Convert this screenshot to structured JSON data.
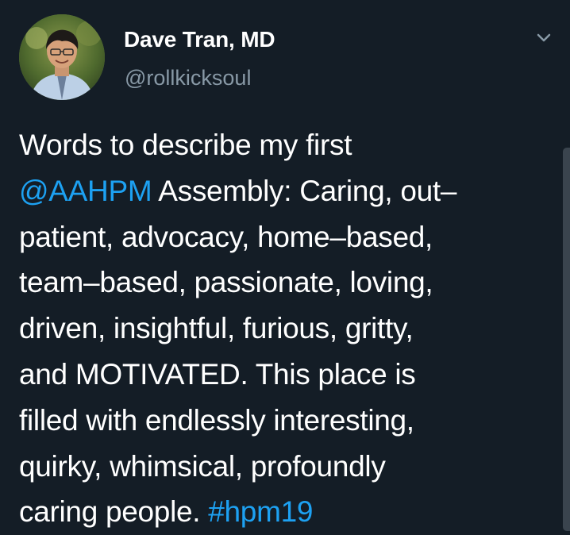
{
  "author": {
    "display_name": "Dave Tran, MD",
    "handle": "@rollkicksoul",
    "avatar_icon": "profile-photo"
  },
  "menu": {
    "icon": "chevron-down-icon"
  },
  "tweet": {
    "lines": [
      [
        {
          "text": "Words to describe my first",
          "kind": "text"
        }
      ],
      [
        {
          "text": "@AAHPM",
          "kind": "mention"
        },
        {
          "text": " Assembly: Caring, out–",
          "kind": "text"
        }
      ],
      [
        {
          "text": "patient, advocacy, home–based,",
          "kind": "text"
        }
      ],
      [
        {
          "text": "team–based, passionate, loving,",
          "kind": "text"
        }
      ],
      [
        {
          "text": "driven, insightful, furious, gritty,",
          "kind": "text"
        }
      ],
      [
        {
          "text": "and MOTIVATED. This place is",
          "kind": "text"
        }
      ],
      [
        {
          "text": "filled with endlessly interesting,",
          "kind": "text"
        }
      ],
      [
        {
          "text": "quirky, whimsical, profoundly",
          "kind": "text"
        }
      ],
      [
        {
          "text": "caring people. ",
          "kind": "text"
        },
        {
          "text": "#hpm19",
          "kind": "hashtag"
        }
      ]
    ]
  },
  "colors": {
    "background": "#141d26",
    "text": "#ffffff",
    "secondary_text": "#8899a6",
    "link": "#1da1f2"
  }
}
